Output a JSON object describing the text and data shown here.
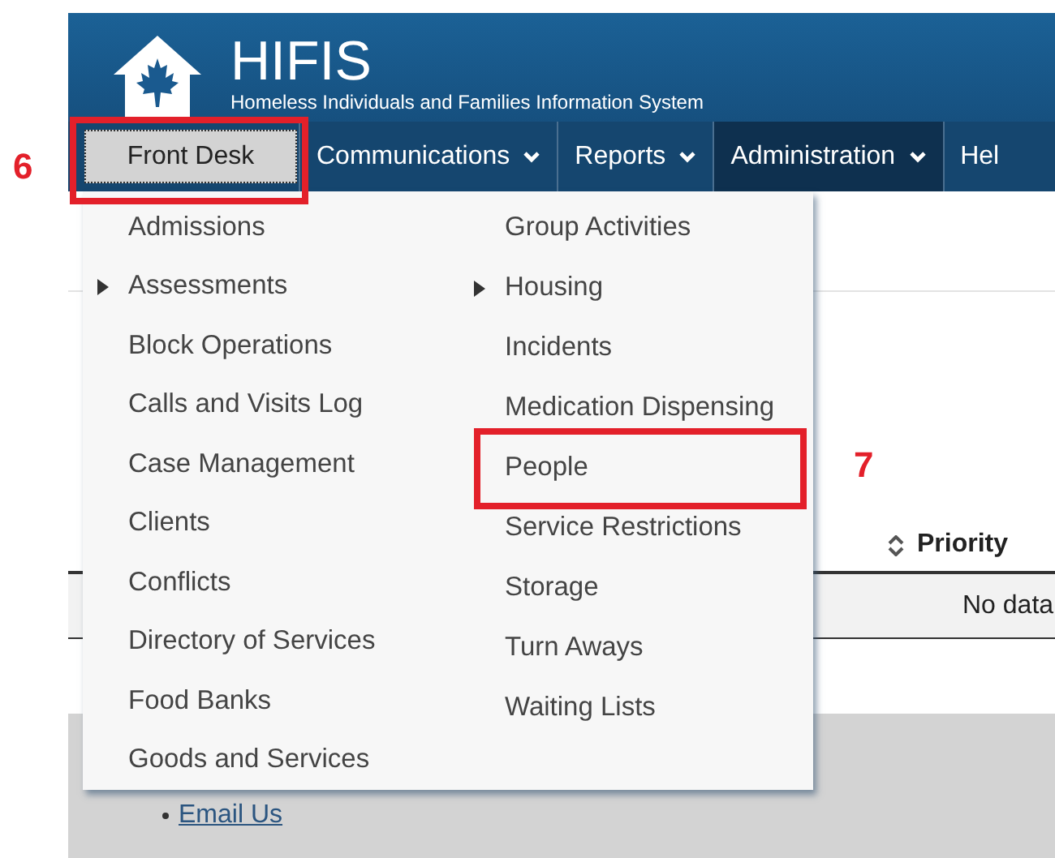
{
  "header": {
    "title": "HIFIS",
    "subtitle": "Homeless Individuals and Families Information System"
  },
  "nav": [
    {
      "label": "Front Desk",
      "selected": true,
      "has_menu": false
    },
    {
      "label": "Communications",
      "selected": false,
      "has_menu": true
    },
    {
      "label": "Reports",
      "selected": false,
      "has_menu": true
    },
    {
      "label": "Administration",
      "selected": false,
      "has_menu": true
    },
    {
      "label": "Hel",
      "selected": false,
      "has_menu": false
    }
  ],
  "menu": {
    "columns": [
      [
        {
          "label": "Admissions",
          "has_submenu": false,
          "highlighted": false
        },
        {
          "label": "Assessments",
          "has_submenu": true,
          "highlighted": false
        },
        {
          "label": "Block Operations",
          "has_submenu": false,
          "highlighted": false
        },
        {
          "label": "Calls and Visits Log",
          "has_submenu": false,
          "highlighted": false
        },
        {
          "label": "Case Management",
          "has_submenu": false,
          "highlighted": false
        },
        {
          "label": "Clients",
          "has_submenu": false,
          "highlighted": false
        },
        {
          "label": "Conflicts",
          "has_submenu": false,
          "highlighted": false
        },
        {
          "label": "Directory of Services",
          "has_submenu": false,
          "highlighted": false
        },
        {
          "label": "Food Banks",
          "has_submenu": false,
          "highlighted": false
        },
        {
          "label": "Goods and Services",
          "has_submenu": false,
          "highlighted": false
        }
      ],
      [
        {
          "label": "Group Activities",
          "has_submenu": false,
          "highlighted": false
        },
        {
          "label": "Housing",
          "has_submenu": true,
          "highlighted": false
        },
        {
          "label": "Incidents",
          "has_submenu": false,
          "highlighted": false
        },
        {
          "label": "Medication Dispensing",
          "has_submenu": false,
          "highlighted": false
        },
        {
          "label": "People",
          "has_submenu": false,
          "highlighted": true
        },
        {
          "label": "Service Restrictions",
          "has_submenu": false,
          "highlighted": false
        },
        {
          "label": "Storage",
          "has_submenu": false,
          "highlighted": false
        },
        {
          "label": "Turn Aways",
          "has_submenu": false,
          "highlighted": false
        },
        {
          "label": "Waiting Lists",
          "has_submenu": false,
          "highlighted": false
        }
      ]
    ]
  },
  "callouts": [
    {
      "label": "6"
    },
    {
      "label": "7"
    }
  ],
  "table": {
    "columns": [
      {
        "label": "Priority",
        "sortable": true
      }
    ],
    "empty_text": "No data"
  },
  "footer": {
    "links": [
      "Email Us"
    ]
  }
}
